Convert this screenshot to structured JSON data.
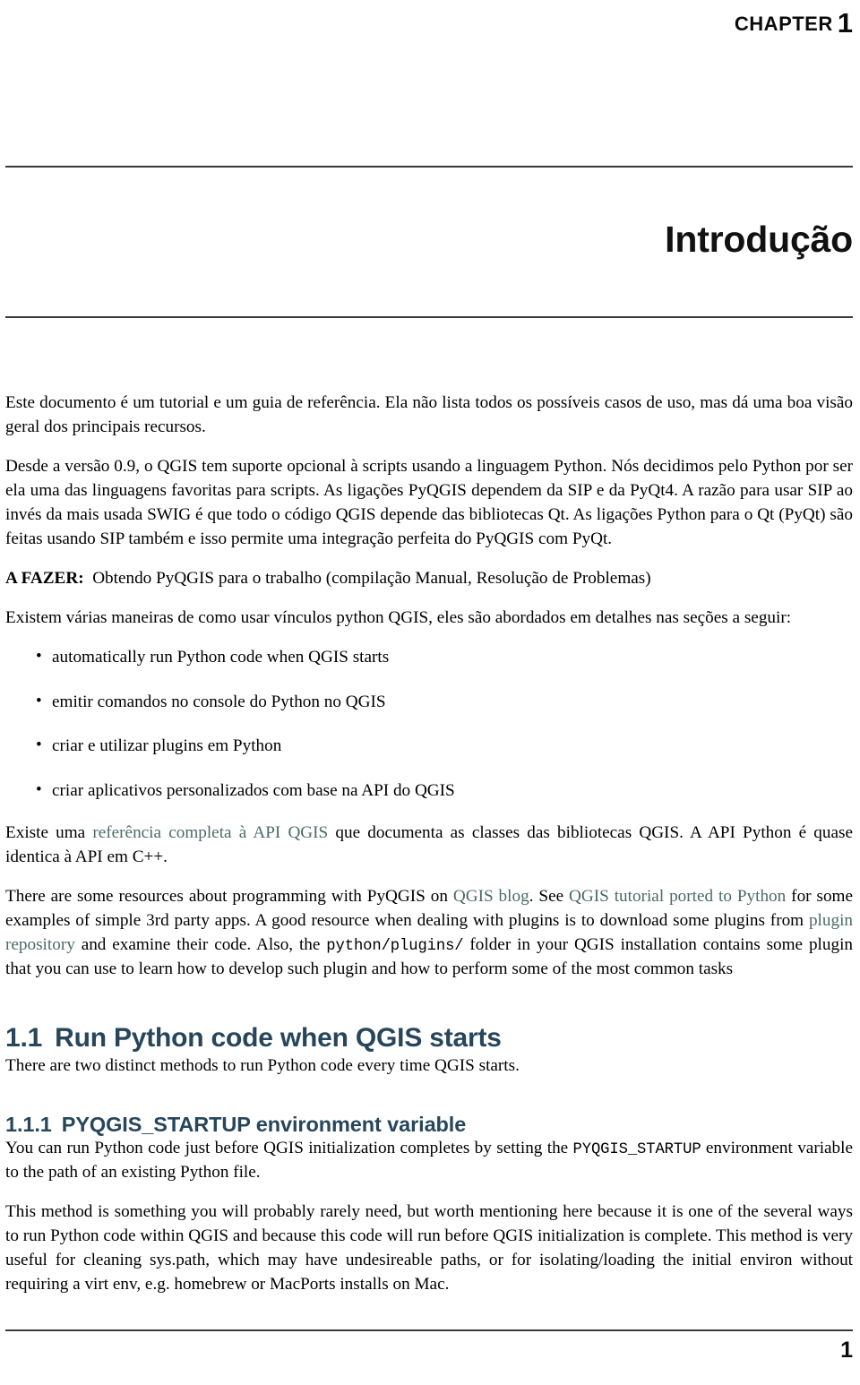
{
  "header": {
    "chapter_word": "CHAPTER",
    "chapter_number": "1"
  },
  "title": "Introdução",
  "colors": {
    "heading": "#27465b",
    "link": "#4b6b67",
    "rule": "#3a3a3a",
    "text": "#000000"
  },
  "body": {
    "p1": "Este documento é um tutorial e um guia de referência. Ela não lista todos os possíveis casos de uso, mas dá uma boa visão geral dos principais recursos.",
    "p2": "Desde a versão 0.9, o QGIS tem suporte opcional à scripts usando a linguagem Python. Nós decidimos pelo Python por ser ela uma das linguagens favoritas para scripts. As ligações PyQGIS dependem da SIP e da PyQt4. A razão para usar SIP ao invés da mais usada SWIG é que todo o código QGIS depende das bibliotecas Qt. As ligações Python para o Qt (PyQt) são feitas usando SIP também e isso permite uma integração perfeita do PyQGIS com PyQt.",
    "todo_label": "A FAZER:",
    "todo_text": "Obtendo PyQGIS para o trabalho (compilação Manual, Resolução de Problemas)",
    "p4": "Existem várias maneiras de como usar vínculos python QGIS, eles são abordados em detalhes nas seções a seguir:",
    "bullets": [
      "automatically run Python code when QGIS starts",
      "emitir comandos no console do Python no QGIS",
      "criar e utilizar plugins em Python",
      "criar aplicativos personalizados com base na API do QGIS"
    ],
    "bullet_marker": "•",
    "p5_a": "Existe uma ",
    "p5_link": "referência completa à API QGIS",
    "p5_b": " que documenta as classes das bibliotecas QGIS. A API Python é quase identica à API em C++.",
    "p6_a": "There are some resources about programming with PyQGIS on ",
    "p6_link1": "QGIS blog",
    "p6_b": ". See ",
    "p6_link2": "QGIS tutorial ported to Python",
    "p6_c": " for some examples of simple 3rd party apps. A good resource when dealing with plugins is to download some plugins from ",
    "p6_link3": "plugin repository",
    "p6_d": " and examine their code. Also, the ",
    "p6_code": "python/plugins/",
    "p6_e": " folder in your QGIS installation contains some plugin that you can use to learn how to develop such plugin and how to perform some of the most common tasks"
  },
  "sections": [
    {
      "number": "1.1",
      "title": "Run Python code when QGIS starts",
      "paragraph": "There are two distinct methods to run Python code every time QGIS starts."
    }
  ],
  "subsections": [
    {
      "number": "1.1.1",
      "title_code": "PYQGIS_STARTUP",
      "title_rest": " environment variable",
      "p1_a": "You can run Python code just before QGIS initialization completes by setting the ",
      "p1_code": "PYQGIS_STARTUP",
      "p1_b": " environment variable to the path of an existing Python file.",
      "p2": "This method is something you will probably rarely need, but worth mentioning here because it is one of the several ways to run Python code within QGIS and because this code will run before QGIS initialization is complete. This method is very useful for cleaning sys.path, which may have undesireable paths, or for isolating/loading the initial environ without requiring a virt env, e.g. homebrew or MacPorts installs on Mac."
    }
  ],
  "footer": {
    "page_number": "1"
  }
}
